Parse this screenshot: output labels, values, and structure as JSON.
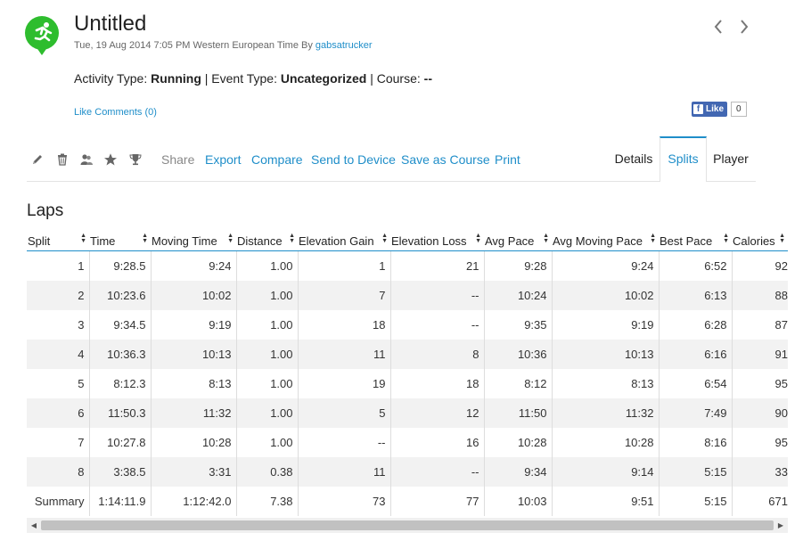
{
  "header": {
    "title": "Untitled",
    "date": "Tue, 19 Aug 2014 7:05 PM Western European Time By ",
    "author": "gabsatrucker",
    "activity_icon": "running-person-icon",
    "accent_color": "#2ebd2e"
  },
  "info": {
    "activity_type_label": "Activity Type: ",
    "activity_type": "Running",
    "event_type_label": " | Event Type: ",
    "event_type": "Uncategorized",
    "course_label": " | Course: ",
    "course": "--"
  },
  "social": {
    "like_label": "Like",
    "comments_label": "Comments (0)",
    "fb_like": "Like",
    "fb_count": "0"
  },
  "toolbar": {
    "share": "Share",
    "export": "Export",
    "compare": "Compare",
    "send_to_device": "Send to Device",
    "save_as_course": "Save as Course",
    "print": "Print"
  },
  "tabs": {
    "details": "Details",
    "splits": "Splits",
    "player": "Player"
  },
  "laps": {
    "heading": "Laps",
    "columns": [
      "Split",
      "Time",
      "Moving Time",
      "Distance",
      "Elevation Gain",
      "Elevation Loss",
      "Avg Pace",
      "Avg Moving Pace",
      "Best Pace",
      "Calories"
    ],
    "rows": [
      [
        "1",
        "9:28.5",
        "9:24",
        "1.00",
        "1",
        "21",
        "9:28",
        "9:24",
        "6:52",
        "92"
      ],
      [
        "2",
        "10:23.6",
        "10:02",
        "1.00",
        "7",
        "--",
        "10:24",
        "10:02",
        "6:13",
        "88"
      ],
      [
        "3",
        "9:34.5",
        "9:19",
        "1.00",
        "18",
        "--",
        "9:35",
        "9:19",
        "6:28",
        "87"
      ],
      [
        "4",
        "10:36.3",
        "10:13",
        "1.00",
        "11",
        "8",
        "10:36",
        "10:13",
        "6:16",
        "91"
      ],
      [
        "5",
        "8:12.3",
        "8:13",
        "1.00",
        "19",
        "18",
        "8:12",
        "8:13",
        "6:54",
        "95"
      ],
      [
        "6",
        "11:50.3",
        "11:32",
        "1.00",
        "5",
        "12",
        "11:50",
        "11:32",
        "7:49",
        "90"
      ],
      [
        "7",
        "10:27.8",
        "10:28",
        "1.00",
        "--",
        "16",
        "10:28",
        "10:28",
        "8:16",
        "95"
      ],
      [
        "8",
        "3:38.5",
        "3:31",
        "0.38",
        "11",
        "--",
        "9:34",
        "9:14",
        "5:15",
        "33"
      ]
    ],
    "summary": [
      "Summary",
      "1:14:11.9",
      "1:12:42.0",
      "7.38",
      "73",
      "77",
      "10:03",
      "9:51",
      "5:15",
      "671"
    ]
  }
}
